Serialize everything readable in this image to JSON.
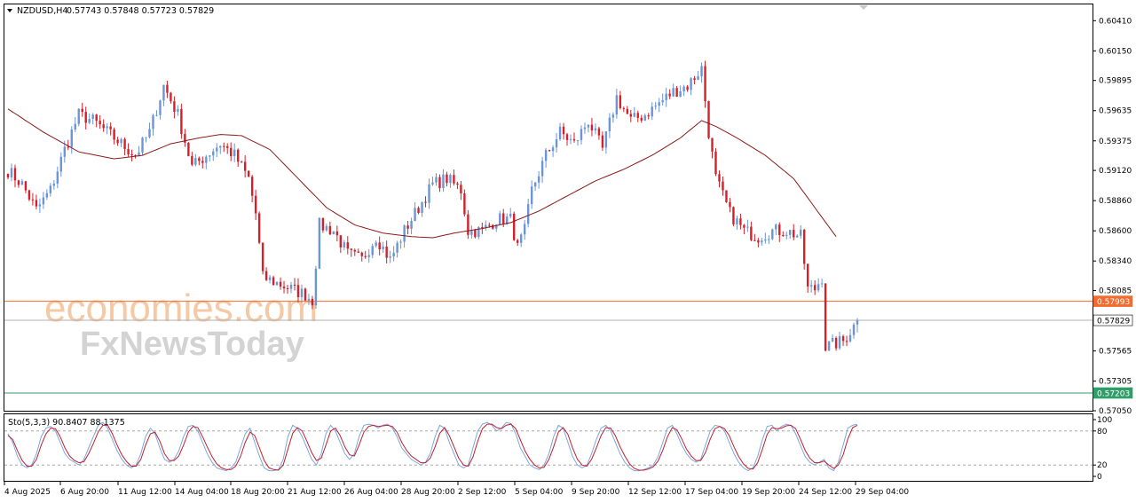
{
  "header": {
    "symbol": "NZDUSD,H4",
    "ohlc": "0.57743 0.57848 0.57723 0.57829"
  },
  "watermark": {
    "brand_1": "economies.com",
    "brand_2": "FxNewsToday"
  },
  "colors": {
    "bull": "#6b95d6",
    "bear": "#d3202a",
    "ma": "#8b1a1a",
    "resistance": "#f26b2f",
    "support": "#2f9e68",
    "last_price_line": "#b0b0b0",
    "stoch_main": "#7ea6e0",
    "stoch_signal": "#c02030"
  },
  "chart_data": [
    {
      "type": "candlestick",
      "symbol": "NZDUSD",
      "timeframe": "H4",
      "ylim": [
        0.5705,
        0.6055
      ],
      "y_ticks": [
        "0.60410",
        "0.60150",
        "0.59895",
        "0.59635",
        "0.59375",
        "0.59120",
        "0.58860",
        "0.58600",
        "0.58340",
        "0.58085",
        "0.57825",
        "0.57565",
        "0.57305",
        "0.57050"
      ],
      "x_ticks": [
        "4 Aug 2025",
        "6 Aug 20:00",
        "11 Aug 12:00",
        "14 Aug 04:00",
        "18 Aug 20:00",
        "21 Aug 12:00",
        "26 Aug 04:00",
        "28 Aug 20:00",
        "2 Sep 12:00",
        "5 Sep 04:00",
        "9 Sep 20:00",
        "12 Sep 12:00",
        "17 Sep 04:00",
        "19 Sep 20:00",
        "24 Sep 12:00",
        "29 Sep 04:00"
      ],
      "price_path": [
        [
          0,
          0.5912
        ],
        [
          4,
          0.59
        ],
        [
          8,
          0.5878
        ],
        [
          12,
          0.5895
        ],
        [
          16,
          0.593
        ],
        [
          20,
          0.596
        ],
        [
          24,
          0.5955
        ],
        [
          28,
          0.5945
        ],
        [
          32,
          0.5935
        ],
        [
          36,
          0.5925
        ],
        [
          40,
          0.5945
        ],
        [
          44,
          0.5985
        ],
        [
          48,
          0.596
        ],
        [
          52,
          0.5915
        ],
        [
          56,
          0.5925
        ],
        [
          60,
          0.5935
        ],
        [
          64,
          0.5925
        ],
        [
          68,
          0.5905
        ],
        [
          70,
          0.5875
        ],
        [
          72,
          0.582
        ],
        [
          76,
          0.5815
        ],
        [
          80,
          0.581
        ],
        [
          84,
          0.5805
        ],
        [
          86,
          0.58
        ],
        [
          88,
          0.5865
        ],
        [
          92,
          0.586
        ],
        [
          96,
          0.584
        ],
        [
          100,
          0.5835
        ],
        [
          104,
          0.5855
        ],
        [
          108,
          0.5835
        ],
        [
          112,
          0.586
        ],
        [
          116,
          0.588
        ],
        [
          120,
          0.59
        ],
        [
          124,
          0.5905
        ],
        [
          128,
          0.5895
        ],
        [
          130,
          0.586
        ],
        [
          134,
          0.586
        ],
        [
          138,
          0.587
        ],
        [
          142,
          0.587
        ],
        [
          144,
          0.5845
        ],
        [
          146,
          0.586
        ],
        [
          148,
          0.5895
        ],
        [
          152,
          0.5925
        ],
        [
          156,
          0.5945
        ],
        [
          160,
          0.5935
        ],
        [
          164,
          0.5955
        ],
        [
          168,
          0.593
        ],
        [
          172,
          0.5975
        ],
        [
          176,
          0.5955
        ],
        [
          180,
          0.596
        ],
        [
          184,
          0.597
        ],
        [
          188,
          0.598
        ],
        [
          192,
          0.5985
        ],
        [
          196,
          0.6
        ],
        [
          198,
          0.5945
        ],
        [
          200,
          0.5905
        ],
        [
          204,
          0.5875
        ],
        [
          208,
          0.586
        ],
        [
          212,
          0.5855
        ],
        [
          216,
          0.586
        ],
        [
          220,
          0.586
        ],
        [
          224,
          0.5855
        ],
        [
          226,
          0.581
        ],
        [
          228,
          0.581
        ],
        [
          230,
          0.582
        ],
        [
          231,
          0.576
        ],
        [
          233,
          0.5762
        ],
        [
          236,
          0.5765
        ],
        [
          239,
          0.5778
        ],
        [
          240,
          0.5783
        ]
      ],
      "moving_average": [
        [
          0,
          0.5965
        ],
        [
          10,
          0.5945
        ],
        [
          20,
          0.5928
        ],
        [
          30,
          0.5922
        ],
        [
          38,
          0.5925
        ],
        [
          46,
          0.5935
        ],
        [
          54,
          0.594
        ],
        [
          60,
          0.5943
        ],
        [
          66,
          0.5942
        ],
        [
          74,
          0.593
        ],
        [
          82,
          0.5905
        ],
        [
          90,
          0.588
        ],
        [
          98,
          0.5865
        ],
        [
          106,
          0.5858
        ],
        [
          114,
          0.5855
        ],
        [
          120,
          0.5854
        ],
        [
          126,
          0.5858
        ],
        [
          134,
          0.5862
        ],
        [
          142,
          0.5867
        ],
        [
          150,
          0.5877
        ],
        [
          158,
          0.589
        ],
        [
          166,
          0.5903
        ],
        [
          174,
          0.5913
        ],
        [
          182,
          0.5925
        ],
        [
          190,
          0.594
        ],
        [
          196,
          0.5955
        ],
        [
          200,
          0.595
        ],
        [
          206,
          0.594
        ],
        [
          214,
          0.5925
        ],
        [
          222,
          0.5905
        ],
        [
          228,
          0.588
        ],
        [
          234,
          0.5855
        ]
      ],
      "horizontal_levels": [
        {
          "label": "0.57993",
          "value": 0.57993
        },
        {
          "label": "0.57829",
          "value": 0.57829
        },
        {
          "label": "0.57203",
          "value": 0.57203
        }
      ]
    },
    {
      "type": "line",
      "title": "Sto(5,3,3) 90.8407 88.1375",
      "ylim": [
        0,
        100
      ],
      "y_ticks": [
        "100",
        "80",
        "20",
        "0"
      ],
      "levels": [
        80,
        20
      ],
      "series": [
        {
          "values": [
            75,
            60,
            35,
            20,
            15,
            20,
            40,
            70,
            85,
            88,
            80,
            60,
            40,
            30,
            25,
            20,
            30,
            50,
            70,
            90,
            95,
            85,
            65,
            45,
            30,
            20,
            15,
            20,
            40,
            70,
            85,
            75,
            50,
            30,
            25,
            30,
            45,
            70,
            88,
            90,
            80,
            60,
            40,
            25,
            15,
            12,
            10,
            15,
            25,
            50,
            75,
            85,
            60,
            35,
            15,
            10,
            10,
            12,
            30,
            70,
            90,
            85,
            70,
            50,
            30,
            20,
            40,
            75,
            90,
            80,
            60,
            40,
            30,
            40,
            70,
            90,
            92,
            90,
            85,
            90,
            92,
            85,
            70,
            50,
            40,
            30,
            25,
            20,
            25,
            40,
            70,
            90,
            85,
            60,
            40,
            20,
            15,
            20,
            50,
            80,
            92,
            95,
            90,
            80,
            85,
            95,
            93,
            75,
            50,
            35,
            20,
            15,
            12,
            20,
            40,
            70,
            90,
            85,
            60,
            35,
            20,
            15,
            20,
            40,
            65,
            85,
            90,
            80,
            60,
            40,
            25,
            15,
            10,
            10,
            12,
            15,
            20,
            35,
            60,
            85,
            90,
            75,
            55,
            40,
            30,
            25,
            30,
            55,
            80,
            90,
            88,
            80,
            60,
            40,
            25,
            15,
            10,
            15,
            35,
            65,
            88,
            90,
            80,
            88,
            92,
            90,
            75,
            55,
            35,
            25,
            20,
            25,
            30,
            15,
            10,
            25,
            55,
            85,
            90,
            92
          ]
        },
        {
          "values": [
            72,
            65,
            45,
            28,
            18,
            18,
            30,
            55,
            75,
            85,
            84,
            70,
            50,
            36,
            28,
            24,
            26,
            40,
            58,
            78,
            90,
            90,
            75,
            55,
            38,
            26,
            18,
            18,
            30,
            55,
            75,
            78,
            62,
            40,
            28,
            28,
            36,
            55,
            78,
            88,
            86,
            70,
            52,
            35,
            22,
            15,
            12,
            12,
            18,
            35,
            60,
            78,
            72,
            50,
            28,
            15,
            12,
            11,
            20,
            48,
            76,
            86,
            80,
            62,
            42,
            28,
            32,
            55,
            80,
            85,
            72,
            52,
            38,
            36,
            55,
            78,
            88,
            90,
            88,
            89,
            90,
            88,
            78,
            60,
            46,
            36,
            30,
            24,
            24,
            32,
            52,
            76,
            86,
            72,
            52,
            32,
            20,
            18,
            34,
            62,
            84,
            92,
            92,
            86,
            84,
            90,
            92,
            84,
            64,
            44,
            30,
            20,
            15,
            16,
            30,
            52,
            78,
            86,
            74,
            50,
            30,
            20,
            18,
            30,
            50,
            72,
            86,
            85,
            72,
            52,
            36,
            22,
            14,
            11,
            11,
            13,
            17,
            27,
            46,
            70,
            86,
            82,
            66,
            48,
            36,
            28,
            28,
            42,
            66,
            84,
            88,
            84,
            72,
            52,
            35,
            22,
            14,
            13,
            24,
            48,
            74,
            86,
            84,
            85,
            89,
            90,
            84,
            66,
            46,
            32,
            24,
            24,
            27,
            20,
            14,
            20,
            38,
            66,
            86,
            90
          ]
        }
      ]
    }
  ]
}
